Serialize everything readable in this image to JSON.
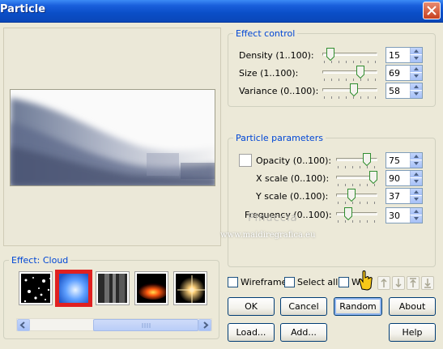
{
  "window": {
    "title": "Particle"
  },
  "effect_control": {
    "legend": "Effect control",
    "rows": [
      {
        "label": "Density (1..100):",
        "value": "15",
        "fraction": 0.14
      },
      {
        "label": "Size (1..100):",
        "value": "69",
        "fraction": 0.69
      },
      {
        "label": "Variance (0..100):",
        "value": "58",
        "fraction": 0.58
      }
    ]
  },
  "particle_parameters": {
    "legend": "Particle parameters",
    "opacity": {
      "label": "Opacity (0..100):",
      "value": "75",
      "fraction": 0.75
    },
    "x_scale": {
      "label": "X scale (0..100):",
      "value": "90",
      "fraction": 0.9
    },
    "y_scale": {
      "label": "Y scale (0..100):",
      "value": "37",
      "fraction": 0.37
    },
    "frequency": {
      "label": "Frequency (0..100):",
      "value": "30",
      "fraction": 0.3
    }
  },
  "effect_panel": {
    "legend": "Effect: Cloud",
    "thumbnails": [
      {
        "name": "stars",
        "selected": false
      },
      {
        "name": "cloud",
        "selected": true
      },
      {
        "name": "smoke",
        "selected": false
      },
      {
        "name": "fire",
        "selected": false
      },
      {
        "name": "flare",
        "selected": false
      }
    ]
  },
  "options": {
    "wireframe": "Wireframe",
    "select_all": "Select all",
    "w_label": "W"
  },
  "buttons": {
    "ok": "OK",
    "cancel": "Cancel",
    "random": "Random",
    "about": "About",
    "load": "Load...",
    "add": "Add...",
    "help": "Help"
  },
  "watermark": {
    "name": "Pinuccia",
    "url": "www.maidiregrafica.eu"
  },
  "colors": {
    "title_blue": "#0a4ec7",
    "legend_blue": "#0046d5",
    "selected_red": "#e02020"
  }
}
